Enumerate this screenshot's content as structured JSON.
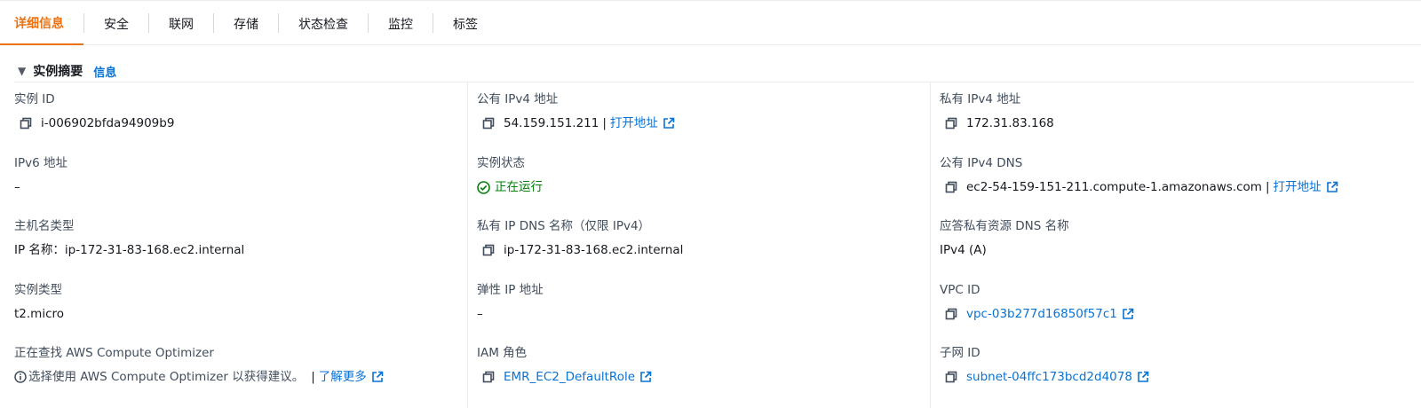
{
  "tabs": [
    "详细信息",
    "安全",
    "联网",
    "存储",
    "状态检查",
    "监控",
    "标签"
  ],
  "section": {
    "title": "实例摘要",
    "info_link": "信息"
  },
  "col1": {
    "instance_id": {
      "label": "实例 ID",
      "value": "i-006902bfda94909b9"
    },
    "ipv6": {
      "label": "IPv6 地址",
      "value": "–"
    },
    "hostname_type": {
      "label": "主机名类型",
      "value": "IP 名称：ip-172-31-83-168.ec2.internal"
    },
    "instance_type": {
      "label": "实例类型",
      "value": "t2.micro"
    },
    "optimizer": {
      "label": "正在查找 AWS Compute Optimizer",
      "value": "选择使用 AWS Compute Optimizer 以获得建议。",
      "pipe": "|",
      "link": "了解更多"
    }
  },
  "col2": {
    "public_ipv4": {
      "label": "公有 IPv4 地址",
      "value": "54.159.151.211",
      "pipe": "|",
      "link": "打开地址"
    },
    "state": {
      "label": "实例状态",
      "value": "正在运行"
    },
    "private_dns": {
      "label": "私有 IP DNS 名称（仅限 IPv4）",
      "value": "ip-172-31-83-168.ec2.internal"
    },
    "elastic_ip": {
      "label": "弹性 IP 地址",
      "value": "–"
    },
    "iam_role": {
      "label": "IAM 角色",
      "value": "EMR_EC2_DefaultRole"
    }
  },
  "col3": {
    "private_ipv4": {
      "label": "私有 IPv4 地址",
      "value": "172.31.83.168"
    },
    "public_dns": {
      "label": "公有 IPv4 DNS",
      "value": "ec2-54-159-151-211.compute-1.amazonaws.com",
      "pipe": "|",
      "link": "打开地址"
    },
    "resource_dns": {
      "label": "应答私有资源 DNS 名称",
      "value": "IPv4 (A)"
    },
    "vpc_id": {
      "label": "VPC ID",
      "value": "vpc-03b277d16850f57c1"
    },
    "subnet_id": {
      "label": "子网 ID",
      "value": "subnet-04ffc173bcd2d4078"
    }
  },
  "colors": {
    "accent": "#ec7211",
    "link": "#0972d3",
    "success": "#037f0c"
  }
}
